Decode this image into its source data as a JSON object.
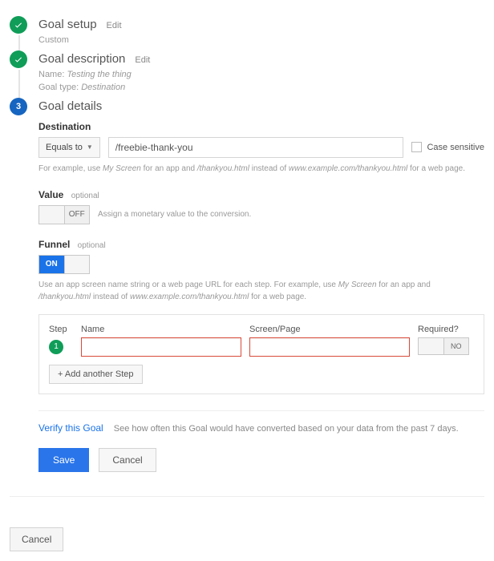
{
  "steps": {
    "setup": {
      "title": "Goal setup",
      "edit": "Edit",
      "sub": "Custom"
    },
    "desc": {
      "title": "Goal description",
      "edit": "Edit",
      "name_lbl": "Name:",
      "name_val": "Testing the thing",
      "type_lbl": "Goal type:",
      "type_val": "Destination"
    },
    "details": {
      "title": "Goal details",
      "num": "3"
    }
  },
  "destination": {
    "label": "Destination",
    "match": "Equals to",
    "value": "/freebie-thank-you",
    "case_sensitive": "Case sensitive",
    "help_pre": "For example, use ",
    "help_it1": "My Screen",
    "help_mid1": " for an app and ",
    "help_it2": "/thankyou.html",
    "help_mid2": " instead of ",
    "help_it3": "www.example.com/thankyou.html",
    "help_post": " for a web page."
  },
  "value": {
    "label": "Value",
    "optional": "optional",
    "off": "OFF",
    "desc": "Assign a monetary value to the conversion."
  },
  "funnel": {
    "label": "Funnel",
    "optional": "optional",
    "on": "ON",
    "help1_a": "Use an app screen name string or a web page URL for each step. For example, use ",
    "help1_it1": "My Screen",
    "help1_b": " for an app and ",
    "help1_it2": "/thankyou.html",
    "help1_c": " instead of ",
    "help1_it3": "www.example.com/thankyou.html",
    "help1_d": " for a web page."
  },
  "table": {
    "h_step": "Step",
    "h_name": "Name",
    "h_screen": "Screen/Page",
    "h_req": "Required?",
    "row_num": "1",
    "req_no": "NO",
    "add": "+ Add another Step"
  },
  "verify": {
    "link": "Verify this Goal",
    "text": "See how often this Goal would have converted based on your data from the past 7 days."
  },
  "buttons": {
    "save": "Save",
    "cancel": "Cancel",
    "footer_cancel": "Cancel"
  }
}
